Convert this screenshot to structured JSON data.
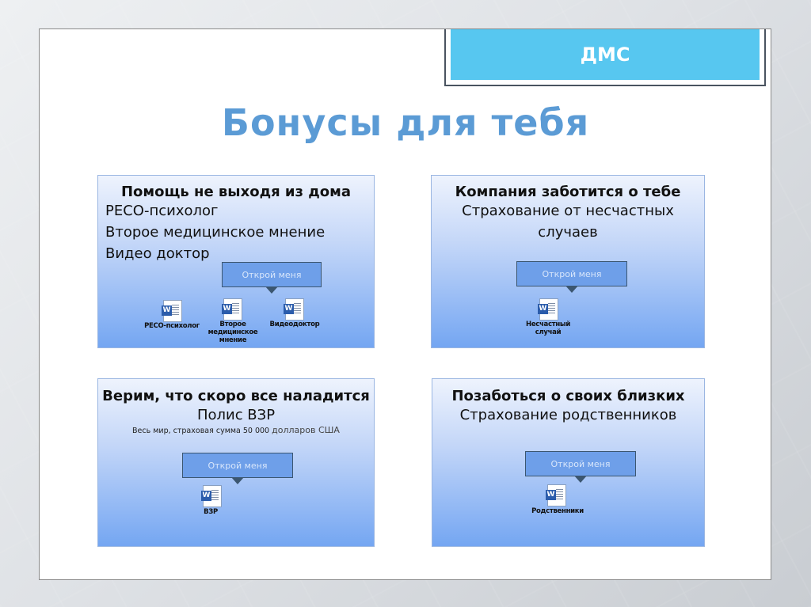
{
  "header": {
    "tag": "ДМС",
    "title": "Бонусы для тебя"
  },
  "cards": [
    {
      "heading": "Помощь не выходя из дома",
      "lines": [
        "РЕСО-психолог",
        "Второе медицинское мнение",
        "Видео доктор"
      ],
      "callout": "Открой меня",
      "files": [
        "РЕСО-психолог",
        "Второе медицинское мнение",
        "Видеодоктор"
      ]
    },
    {
      "heading": "Компания заботится о тебе",
      "lines": [
        "Страхование от несчастных",
        "случаев"
      ],
      "callout": "Открой меня",
      "files": [
        "Несчастный случай"
      ]
    },
    {
      "heading": "Верим, что скоро все наладится",
      "lines": [
        "Полис ВЗР"
      ],
      "note": "Весь мир, страховая сумма 50 000",
      "note_big": "долларов США",
      "callout": "Открой меня",
      "files": [
        "ВЗР"
      ]
    },
    {
      "heading": "Позаботься о своих близких",
      "lines": [
        "Страхование родственников"
      ],
      "callout": "Открой меня",
      "files": [
        "Родственники"
      ]
    }
  ]
}
